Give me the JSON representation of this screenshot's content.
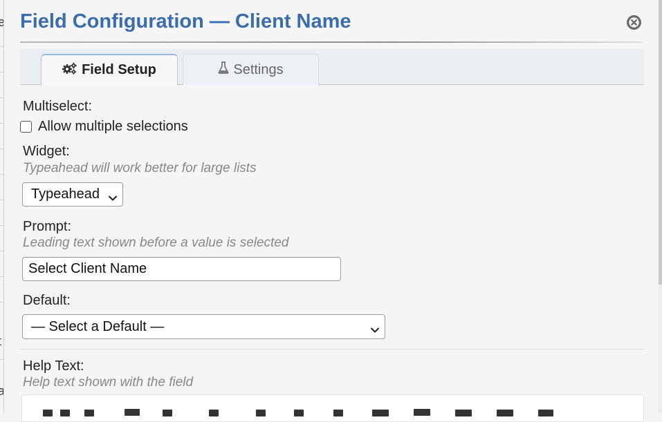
{
  "dialog": {
    "title": "Field Configuration — Client Name",
    "close_icon": "close-circle-icon"
  },
  "tabs": [
    {
      "label": "Field Setup",
      "icon": "gears-icon",
      "active": true
    },
    {
      "label": "Settings",
      "icon": "flask-icon",
      "active": false
    }
  ],
  "multiselect": {
    "label": "Multiselect:",
    "checkbox_label": "Allow multiple selections",
    "checked": false
  },
  "widget": {
    "label": "Widget:",
    "hint": "Typeahead will work better for large lists",
    "selected": "Typeahead"
  },
  "prompt": {
    "label": "Prompt:",
    "hint": "Leading text shown before a value is selected",
    "value": "Select Client Name"
  },
  "default": {
    "label": "Default:",
    "selected": "— Select a Default —"
  },
  "help_text": {
    "label": "Help Text:",
    "hint": "Help text shown with the field"
  },
  "colors": {
    "title": "#3a6db0",
    "hint": "#888888"
  }
}
